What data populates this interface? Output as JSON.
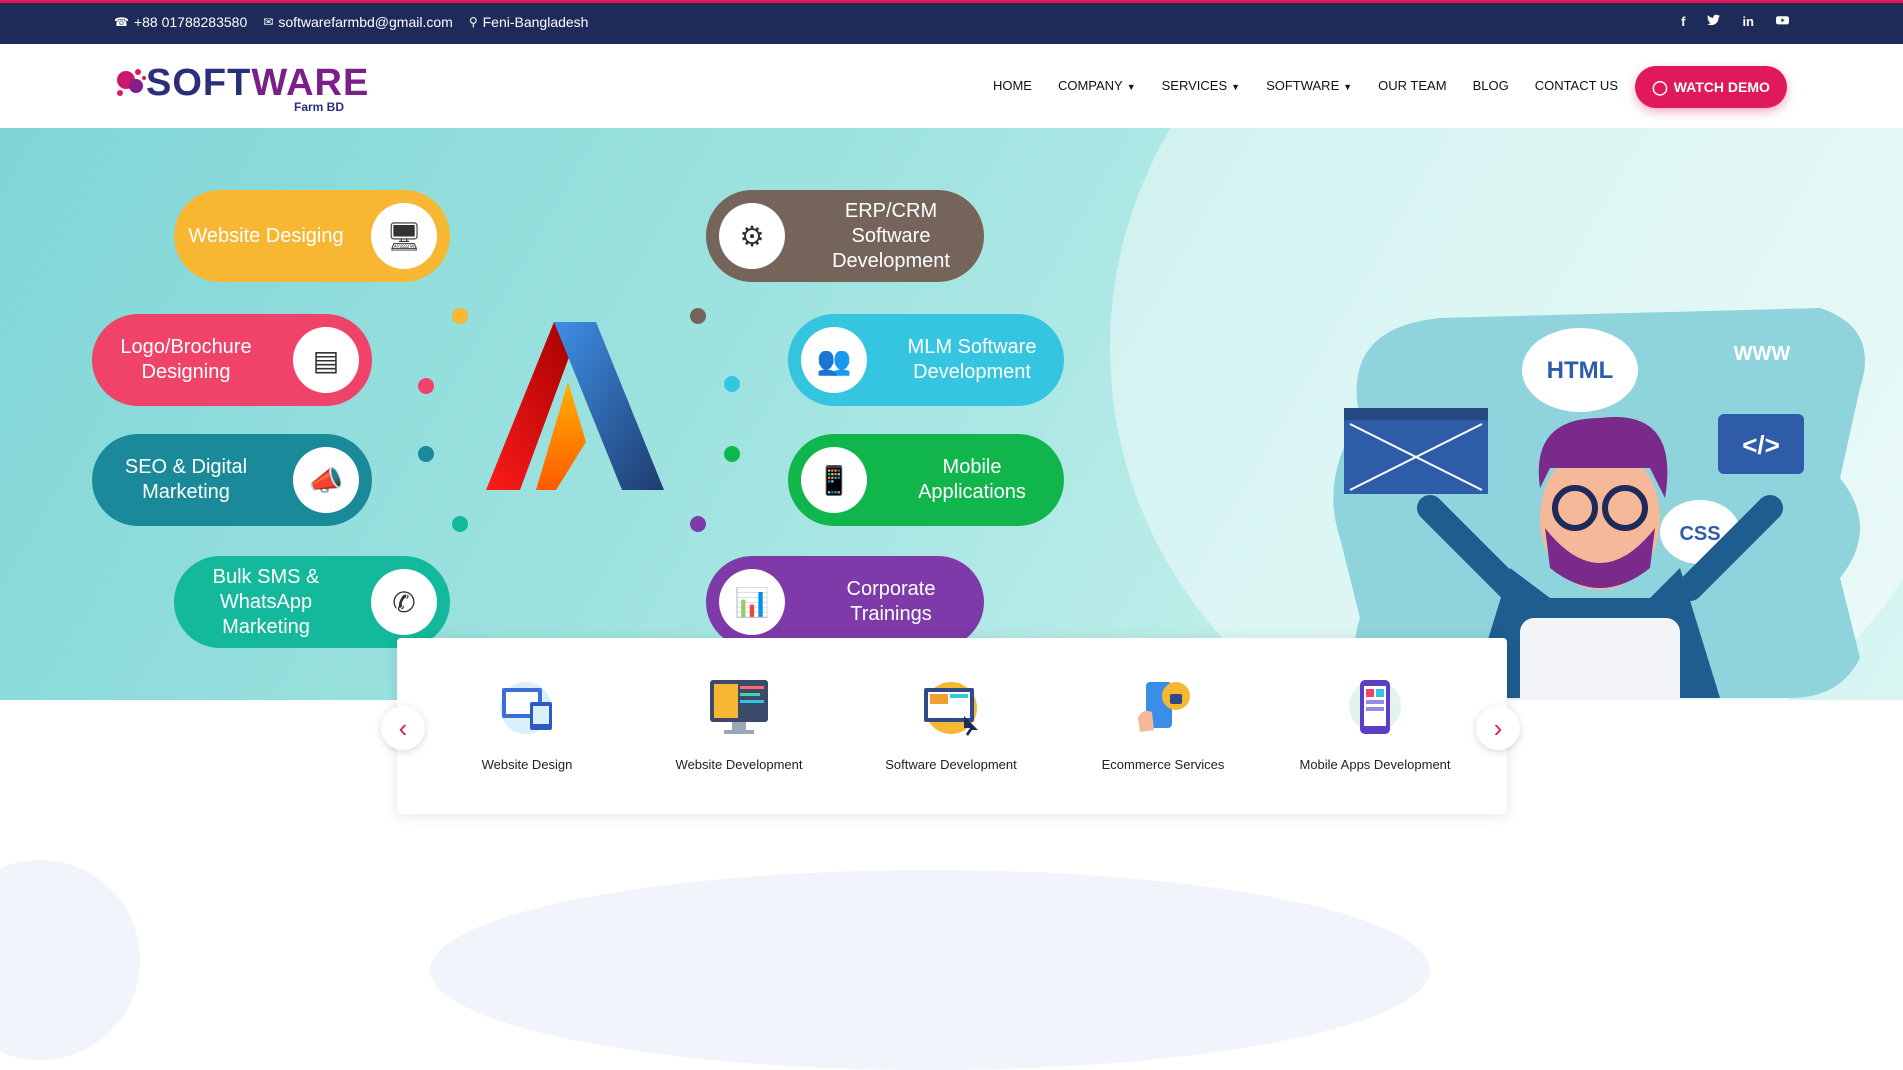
{
  "topbar": {
    "phone": "+88 01788283580",
    "email": "softwarefarmbd@gmail.com",
    "location": "Feni-Bangladesh",
    "social": [
      "f",
      "t",
      "in",
      "yt"
    ]
  },
  "logo": {
    "word1": "SOFT",
    "word2": "WARE",
    "sub": "Farm BD"
  },
  "nav": {
    "home": "HOME",
    "company": "COMPANY",
    "services": "SERVICES",
    "software": "SOFTWARE",
    "team": "OUR TEAM",
    "blog": "BLOG",
    "contact": "CONTACT US",
    "demo": "WATCH DEMO"
  },
  "hero": {
    "pills": {
      "website": "Website Desiging",
      "logo": "Logo/Brochure Designing",
      "seo": "SEO & Digital Marketing",
      "sms": "Bulk SMS & WhatsApp Marketing",
      "erp": "ERP/CRM Software Development",
      "mlm": "MLM Software Development",
      "mobile": "Mobile Applications",
      "corporate": "Corporate Trainings"
    },
    "illus": {
      "html": "HTML",
      "www": "WWW",
      "code": "</>",
      "css": "CSS"
    }
  },
  "cards": [
    {
      "label": "Website Design"
    },
    {
      "label": "Website Development"
    },
    {
      "label": "Software Development"
    },
    {
      "label": "Ecommerce Services"
    },
    {
      "label": "Mobile Apps Development"
    }
  ],
  "colors": {
    "accent": "#e0195b",
    "topbar": "#1e2a5a",
    "yellow": "#f7b733",
    "pink": "#f0436a",
    "teal_dark": "#1a8a9a",
    "green": "#14b89a",
    "brown": "#756459",
    "cyan": "#36c5e0",
    "green2": "#10b54c",
    "purple": "#7d3aa8"
  }
}
